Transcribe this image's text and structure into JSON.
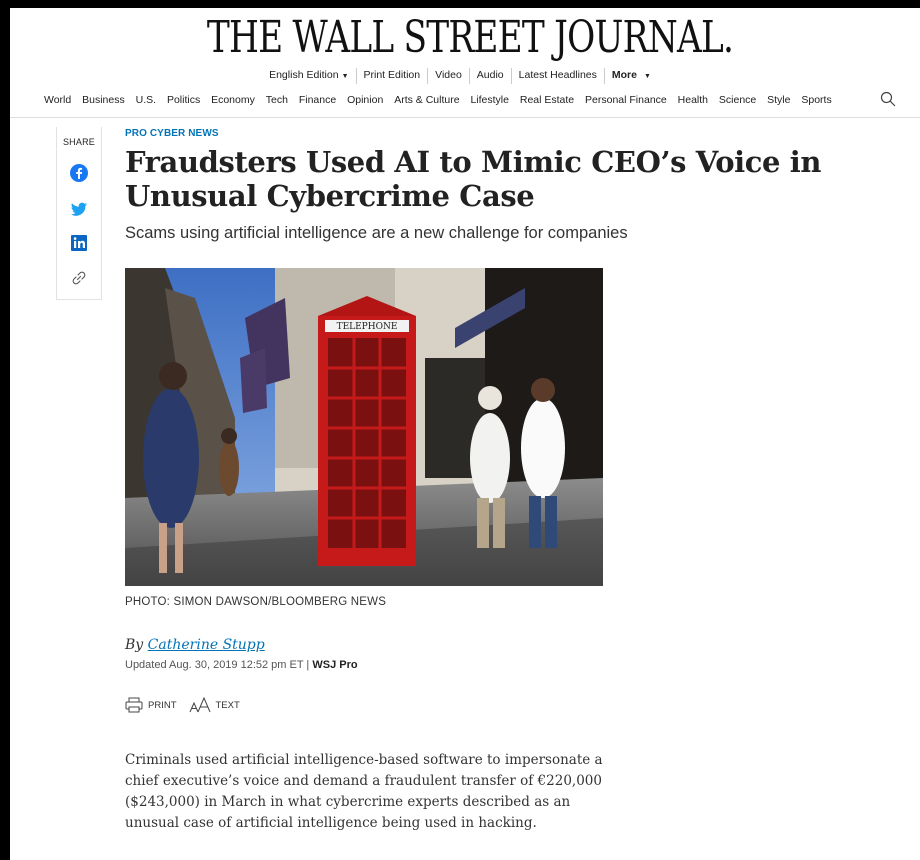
{
  "masthead": "THE WALL STREET JOURNAL.",
  "edition_bar": [
    "English Edition",
    "Print Edition",
    "Video",
    "Audio",
    "Latest Headlines",
    "More"
  ],
  "nav": [
    "World",
    "Business",
    "U.S.",
    "Politics",
    "Economy",
    "Tech",
    "Finance",
    "Opinion",
    "Arts & Culture",
    "Lifestyle",
    "Real Estate",
    "Personal Finance",
    "Health",
    "Science",
    "Style",
    "Sports"
  ],
  "share": {
    "label": "SHARE",
    "icons": [
      "facebook-icon",
      "twitter-icon",
      "linkedin-icon",
      "link-icon"
    ]
  },
  "article": {
    "kicker": "PRO CYBER NEWS",
    "headline": "Fraudsters Used AI to Mimic CEO’s Voice in Unusual Cybercrime Case",
    "dek": "Scams using artificial intelligence are a new challenge for companies",
    "photo_caption": "PHOTO: SIMON DAWSON/BLOOMBERG NEWS",
    "byline_prefix": "By ",
    "author": "Catherine Stupp",
    "updated": "Updated Aug. 30, 2019 12:52 pm ET | ",
    "section_tag": "WSJ Pro",
    "tools": {
      "print": "PRINT",
      "text": "TEXT"
    },
    "body": "Criminals used artificial intelligence-based software to impersonate a chief executive’s voice and demand a fraudulent transfer of €220,000 ($243,000) in March in what cybercrime experts described as an unusual case of artificial intelligence being used in hacking."
  },
  "photo_signage": "TELEPHONE",
  "colors": {
    "accent": "#0274b6",
    "phonebox": "#d01818",
    "facebook": "#1877f2",
    "twitter": "#1da1f2",
    "linkedin": "#0a66c2"
  }
}
